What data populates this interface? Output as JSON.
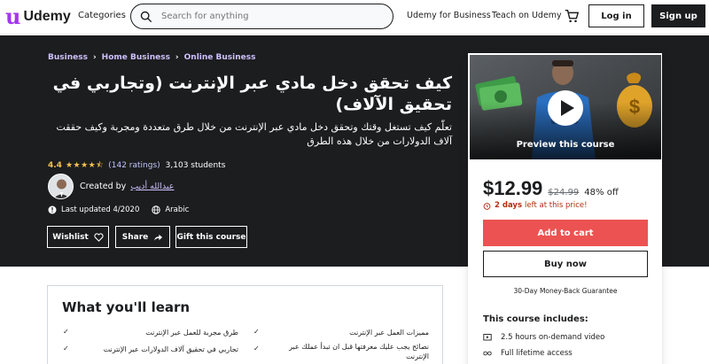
{
  "nav": {
    "logo_mark": "u",
    "logo_text": "Udemy",
    "categories": "Categories",
    "search_placeholder": "Search for anything",
    "business_link": "Udemy for Business",
    "teach_link": "Teach on Udemy",
    "login": "Log in",
    "signup": "Sign up"
  },
  "breadcrumb": [
    "Business",
    "Home Business",
    "Online Business"
  ],
  "course": {
    "title": "كيف تحقق دخل مادي عبر الإنترنت (وتجاربي في تحقيق الآلاف)",
    "subtitle": "تعلّم كيف تستغل وقتك وتحقق دخل مادي عبر الإنترنت من خلال طرق متعددة ومجربة وكيف حققت آلاف الدولارات من خلال هذه الطرق",
    "rating": "4.4",
    "stars": "★★★★⯪",
    "rating_count": "(142 ratings)",
    "students": "3,103 students",
    "created_by": "Created by",
    "creator": "عبدالله أديب",
    "last_updated": "Last updated 4/2020",
    "language": "Arabic"
  },
  "actions": {
    "wishlist": "Wishlist",
    "share": "Share",
    "gift": "Gift this course"
  },
  "sidebar": {
    "preview_label": "Preview this course",
    "price": "$12.99",
    "original_price": "$24.99",
    "discount": "48% off",
    "timer_bold": "2 days",
    "timer_rest": "left at this price!",
    "add_to_cart": "Add to cart",
    "buy_now": "Buy now",
    "guarantee": "30-Day Money-Back Guarantee",
    "includes_title": "This course includes:",
    "includes": [
      "2.5 hours on-demand video",
      "Full lifetime access"
    ]
  },
  "learn": {
    "title": "What you'll learn",
    "items": [
      "مميزات العمل عبر الإنترنت",
      "طرق مجربة للعمل عبر الإنترنت",
      "نصائح يجب عليك معرفتها قبل ان تبدأ عملك عبر الإنترنت",
      "تجاربي في تحقيق آلاف الدولارات عبر الإنترنت"
    ]
  },
  "colors": {
    "brand": "#a435f0",
    "hero_bg": "#1c1d1f",
    "link_purple": "#cec0fc",
    "star": "#f4c150",
    "cart_red": "#ec5252",
    "timer_red": "#b32d0f"
  },
  "icons": [
    "search-icon",
    "cart-icon",
    "alarm-icon",
    "globe-icon",
    "heart-icon",
    "share-arrow-icon",
    "play-icon",
    "video-icon",
    "infinity-icon",
    "check-icon"
  ]
}
